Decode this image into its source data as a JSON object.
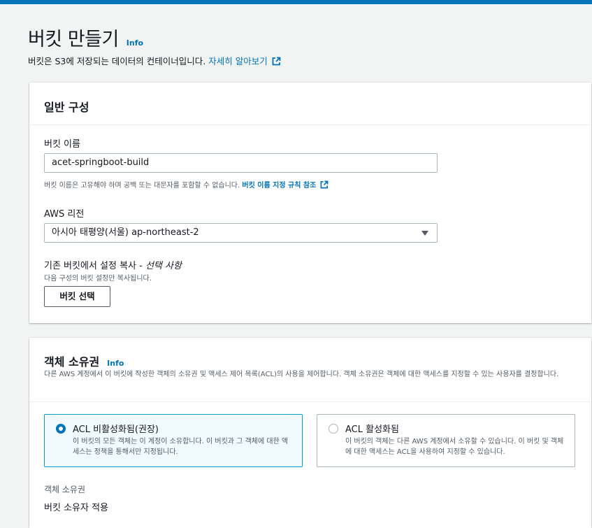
{
  "header": {
    "title": "버킷 만들기",
    "info": "Info",
    "subtitle": "버킷은 S3에 저장되는 데이터의 컨테이너입니다.",
    "learn_more": "자세히 알아보기"
  },
  "general": {
    "title": "일반 구성",
    "bucket_name_label": "버킷 이름",
    "bucket_name_value": "acet-springboot-build",
    "bucket_name_hint": "버킷 이름은 고유해야 하며 공백 또는 대문자를 포함할 수 없습니다.",
    "bucket_name_rules_link": "버킷 이름 지정 규칙 참조",
    "region_label": "AWS 리전",
    "region_value": "아시아 태평양(서울) ap-northeast-2",
    "copy_label": "기존 버킷에서 설정 복사 - ",
    "copy_label_optional": "선택 사항",
    "copy_hint": "다음 구성의 버킷 설정만 복사됩니다.",
    "choose_bucket_button": "버킷 선택"
  },
  "ownership": {
    "title": "객체 소유권",
    "info": "Info",
    "description": "다른 AWS 계정에서 이 버킷에 작성한 객체의 소유권 및 액세스 제어 목록(ACL)의 사용을 제어합니다. 객체 소유권은 객체에 대한 액세스를 지정할 수 있는 사용자를 결정합니다.",
    "options": [
      {
        "title": "ACL 비활성화됨(권장)",
        "description": "이 버킷의 모든 객체는 이 계정이 소유합니다. 이 버킷과 그 객체에 대한 액세스는 정책을 통해서만 지정됩니다.",
        "selected": true
      },
      {
        "title": "ACL 활성화됨",
        "description": "이 버킷의 객체는 다른 AWS 계정에서 소유할 수 있습니다. 이 버킷 및 객체에 대한 액세스는 ACL을 사용하여 지정할 수 있습니다.",
        "selected": false
      }
    ],
    "field_label": "객체 소유권",
    "field_value": "버킷 소유자 적용"
  },
  "colors": {
    "accent": "#0073bb",
    "selected_border": "#00a1c9",
    "selected_bg": "#f1faff"
  },
  "icons": {
    "external_link": "external-link-icon",
    "dropdown": "caret-down-icon"
  }
}
